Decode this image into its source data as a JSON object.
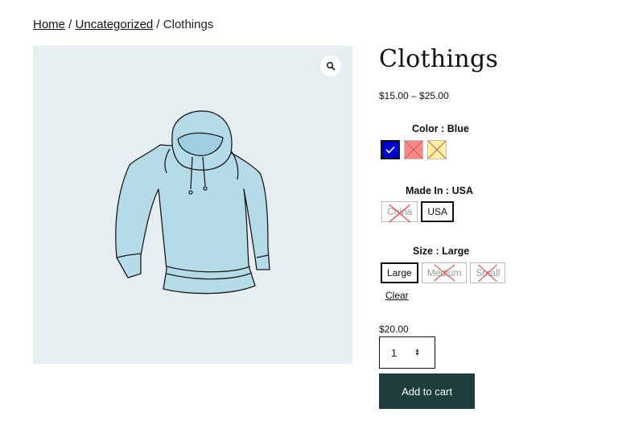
{
  "breadcrumb": {
    "home": "Home",
    "sep1": " / ",
    "category": "Uncategorized",
    "sep2": " / ",
    "current": "Clothings"
  },
  "product": {
    "title": "Clothings",
    "price_range": "$15.00 – $25.00"
  },
  "color": {
    "label": "Color : Blue",
    "options": [
      {
        "name": "Blue",
        "color": "#0000cc",
        "selected": true
      },
      {
        "name": "Red",
        "color": "#f58a8a",
        "available": false
      },
      {
        "name": "Yellow",
        "color": "#fff2a0",
        "available": false
      }
    ]
  },
  "made_in": {
    "label": "Made In : USA",
    "options": [
      "China",
      "USA"
    ]
  },
  "size": {
    "label": "Size : Large",
    "options": [
      "Large",
      "Medium",
      "Small"
    ]
  },
  "clear_label": "Clear",
  "variation_price": "$20.00",
  "quantity": "1",
  "add_to_cart_label": "Add to cart",
  "colors": {
    "button": "#1d3d3f",
    "gallery_bg": "#e6eef1"
  }
}
